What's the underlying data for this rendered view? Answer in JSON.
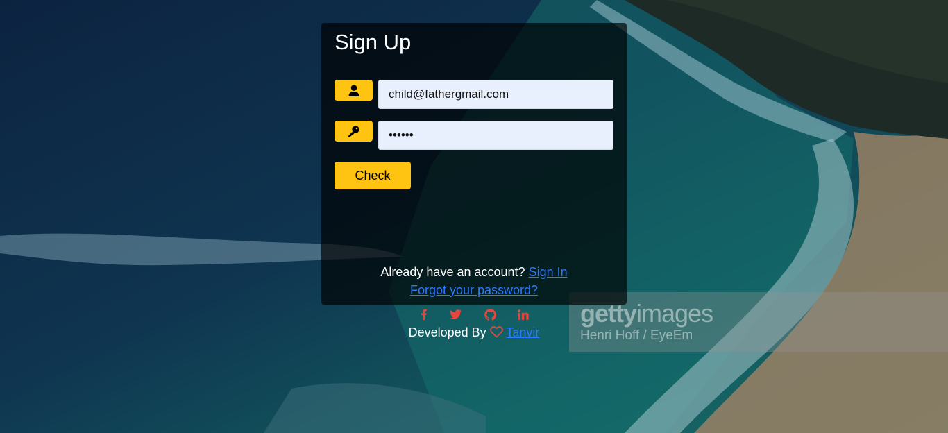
{
  "header": {
    "title": "Sign Up"
  },
  "form": {
    "user_icon": "user-icon",
    "key_icon": "key-icon",
    "email_value": "child@fathergmail.com",
    "password_value": "••••••",
    "submit_label": "Check"
  },
  "footer_links": {
    "already_text": "Already have an account?",
    "sign_in_label": "Sign In",
    "forgot_label": "Forgot your password?"
  },
  "social": {
    "icons": [
      "facebook-icon",
      "twitter-icon",
      "github-icon",
      "linkedin-icon"
    ],
    "color": "#e8453c"
  },
  "credit": {
    "developed_by": "Developed By",
    "heart_icon": "heart-icon",
    "author": "Tanvir"
  },
  "watermark": {
    "brand_bold": "getty",
    "brand_light": "images",
    "photographer": "Henri Hoff / EyeEm"
  },
  "colors": {
    "accent": "#ffc312",
    "link": "#2b7bff",
    "input_bg": "#e8f0fe"
  }
}
